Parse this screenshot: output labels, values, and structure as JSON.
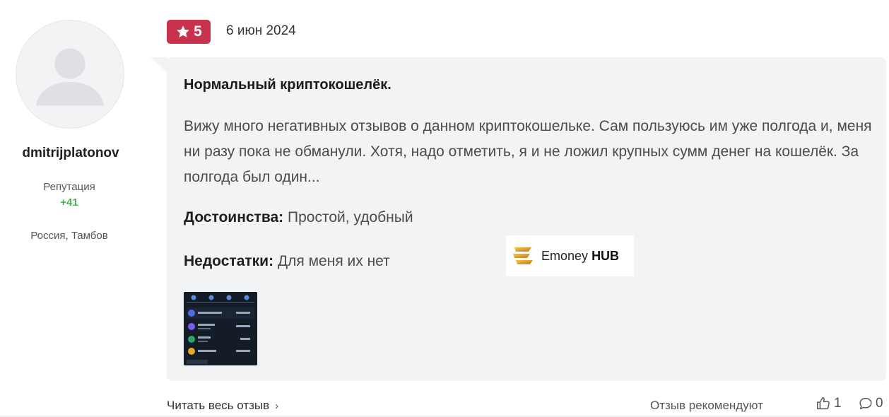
{
  "user": {
    "username": "dmitrijplatonov",
    "reputation_label": "Репутация",
    "reputation_value": "+41",
    "location": "Россия, Тамбов",
    "avatar_icon": "default-user-avatar"
  },
  "review": {
    "rating": "5",
    "rating_icon": "star-icon",
    "date": "6 июн 2024",
    "title": "Нормальный криптокошелёк.",
    "text": "Вижу много негативных отзывов о данном криптокошельке. Сам пользуюсь им уже полгода и, меня ни разу пока не обманули. Хотя, надо отметить, я и не ложил крупных сумм денег на кошелёк. За полгода был один...",
    "pros_label": "Достоинства:",
    "pros_value": "Простой, удобный",
    "cons_label": "Недостатки:",
    "cons_value": "Для меня их нет"
  },
  "watermark": {
    "brand_regular": "Emoney",
    "brand_bold": "HUB"
  },
  "footer": {
    "read_more": "Читать весь отзыв",
    "read_more_icon": "chevron-right-icon",
    "recommend_label": "Отзыв рекомендуют",
    "likes_count": "1",
    "comments_count": "0"
  },
  "colors": {
    "rating_badge": "#c8324d",
    "reputation": "#4caf50",
    "bubble_bg": "#f2f3f5"
  }
}
